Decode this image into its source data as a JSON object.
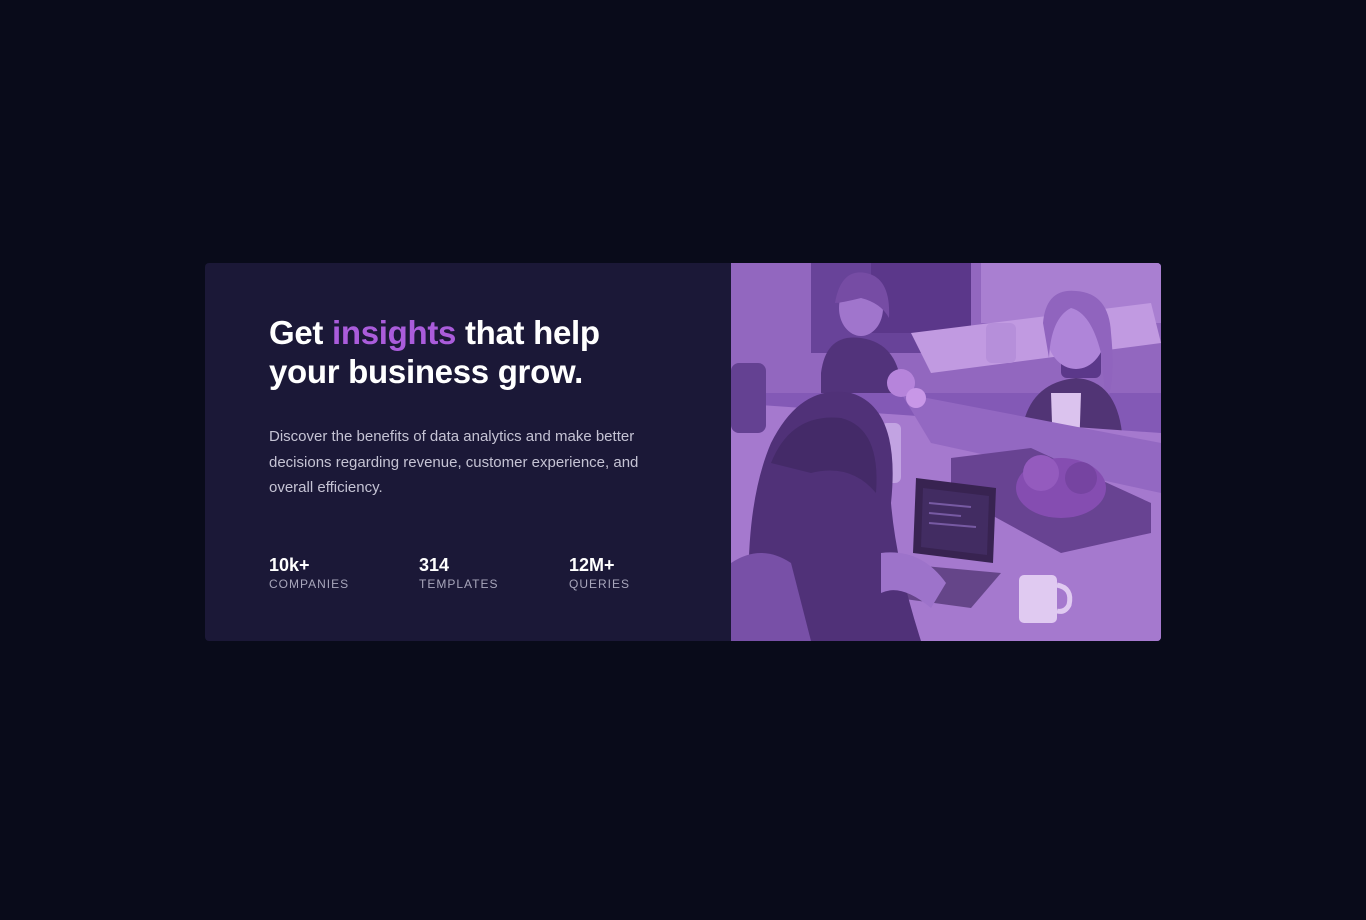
{
  "card": {
    "headline": {
      "before": "Get ",
      "accent": "insights",
      "after": " that help your business grow."
    },
    "description": "Discover the benefits of data analytics and make better decisions regarding revenue, customer experience, and overall efficiency.",
    "stats": [
      {
        "value": "10k+",
        "label": "COMPANIES"
      },
      {
        "value": "314",
        "label": "TEMPLATES"
      },
      {
        "value": "12M+",
        "label": "QUERIES"
      }
    ],
    "image": {
      "icon": "office-team-photo",
      "overlay_color": "#aa5cdb"
    }
  },
  "colors": {
    "page_bg": "#090b1a",
    "card_bg": "#1b1837",
    "accent": "#aa5cdb",
    "text_primary": "#ffffff",
    "text_secondary": "#c5c3d4",
    "text_muted": "#a8a6bb"
  }
}
